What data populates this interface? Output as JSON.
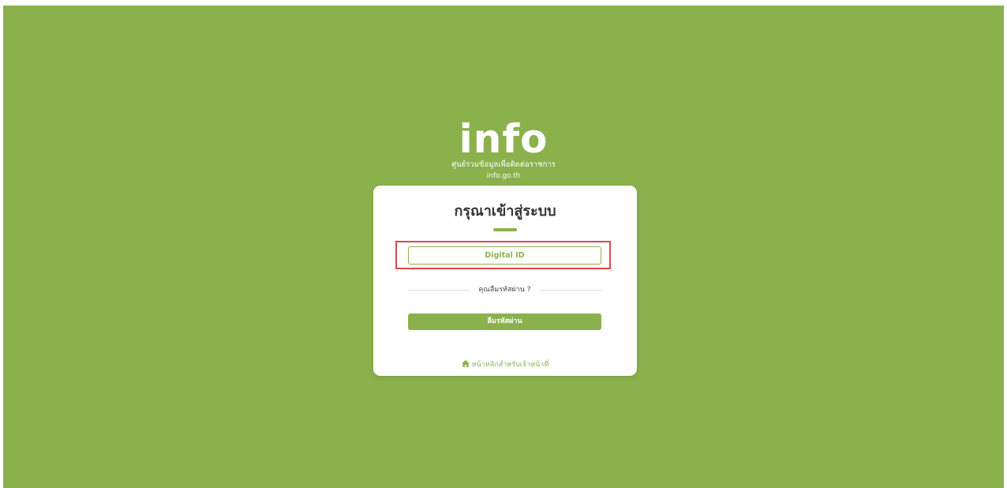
{
  "brand": {
    "logo": "info",
    "tagline": "ศูนย์รวมข้อมูลเพื่อติดต่อราชการ",
    "site": "info.go.th"
  },
  "login": {
    "title": "กรุณาเข้าสู่ระบบ",
    "digital_id_label": "Digital ID",
    "forgot_prompt": "คุณลืมรหัสผ่าน ?",
    "forgot_button_label": "ลืมรหัสผ่าน",
    "home_link_label": "หน้าหลักสำหรับเจ้าหน้าที่",
    "home_icon": "home-icon"
  },
  "colors": {
    "background": "#8bb14d",
    "accent": "#8bb14d",
    "highlight": "#e0474c",
    "card": "#ffffff"
  }
}
